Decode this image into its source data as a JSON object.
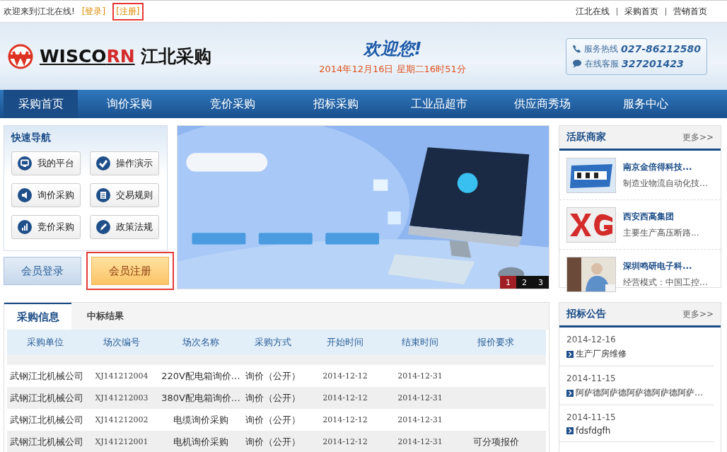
{
  "top_bar": {
    "welcome": "欢迎来到江北在线!",
    "links": [
      {
        "label": "[登录]",
        "highlighted": false
      },
      {
        "label": "[注册]",
        "highlighted": true
      }
    ],
    "right_links": [
      "江北在线",
      "采购首页",
      "营销首页"
    ]
  },
  "header": {
    "brand_latin_a": "WISCO",
    "brand_latin_b": "RN",
    "brand_cn": "江北采购",
    "greeting": "欢迎您!",
    "datetime": "2014年12月16日 星期二16时51分",
    "contacts": [
      {
        "kind": "phone",
        "label": "服务热线",
        "value": "027-86212580"
      },
      {
        "kind": "chat",
        "label": "在线客服",
        "value": "327201423"
      }
    ]
  },
  "nav": [
    {
      "label": "采购首页",
      "selected": true
    },
    {
      "label": "询价采购",
      "selected": false
    },
    {
      "label": "竞价采购",
      "selected": false
    },
    {
      "label": "招标采购",
      "selected": false
    },
    {
      "label": "工业品超市",
      "selected": false
    },
    {
      "label": "供应商秀场",
      "selected": false
    },
    {
      "label": "服务中心",
      "selected": false
    }
  ],
  "quick_nav": {
    "title": "快速导航",
    "items": [
      {
        "kind": "monitor",
        "label": "我的平台"
      },
      {
        "kind": "check",
        "label": "操作演示"
      },
      {
        "kind": "speaker",
        "label": "询价采购"
      },
      {
        "kind": "list",
        "label": "交易规则"
      },
      {
        "kind": "bars",
        "label": "竞价采购"
      },
      {
        "kind": "pen",
        "label": "政策法规"
      }
    ]
  },
  "member_buttons": [
    {
      "label": "会员登录",
      "kind": "login",
      "highlighted": false
    },
    {
      "label": "会员注册",
      "kind": "register",
      "highlighted": true
    }
  ],
  "banner": {
    "kind": "picture",
    "pages": [
      {
        "label": "1",
        "selected": true
      },
      {
        "label": "2",
        "selected": false
      },
      {
        "label": "3",
        "selected": false
      }
    ]
  },
  "merchants": {
    "title": "活跃商家",
    "more": "更多>>",
    "items": [
      {
        "name": "南京金倍得科技...",
        "desc": "制造业物流自动化技…"
      },
      {
        "name": "西安西高集团",
        "desc": "主要生产高压断路..."
      },
      {
        "name": "深圳鸣研电子科...",
        "desc": "经营模式：中国工控…"
      }
    ]
  },
  "tabs": [
    {
      "label": "采购信息",
      "selected": true
    },
    {
      "label": "中标结果",
      "selected": false
    }
  ],
  "table": {
    "columns": [
      "采购单位",
      "场次编号",
      "场次名称",
      "采购方式",
      "开始时间",
      "结束时间",
      "报价要求"
    ],
    "rows": [
      [
        "武钢江北机械公司",
        "XJ141212004",
        "220V配电箱询价…",
        "询价（公开）",
        "2014-12-12",
        "2014-12-31",
        ""
      ],
      [
        "武钢江北机械公司",
        "XJ141212003",
        "380V配电箱询价…",
        "询价（公开）",
        "2014-12-12",
        "2014-12-31",
        ""
      ],
      [
        "武钢江北机械公司",
        "XJ141212002",
        "电缆询价采购",
        "询价（公开）",
        "2014-12-12",
        "2014-12-31",
        ""
      ],
      [
        "武钢江北机械公司",
        "XJ141212001",
        "电机询价采购",
        "询价（公开）",
        "2014-12-12",
        "2014-12-31",
        "可分项报价"
      ]
    ]
  },
  "notices": {
    "title": "招标公告",
    "more": "更多>>",
    "items": [
      {
        "date": "2014-12-16",
        "title": "生产厂房维修"
      },
      {
        "date": "2014-11-15",
        "title": "阿萨德阿萨德阿萨德阿萨德阿萨…"
      },
      {
        "date": "2014-11-15",
        "title": "fdsfdgfh"
      }
    ]
  }
}
